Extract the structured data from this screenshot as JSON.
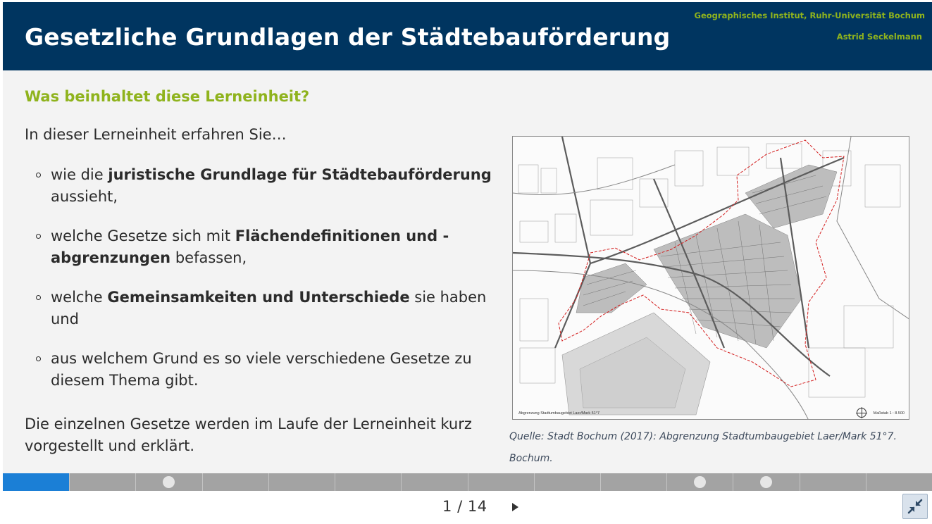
{
  "header": {
    "title": "Gesetzliche Grundlagen der Städtebauförderung",
    "institute": "Geographisches Institut, Ruhr-Universität Bochum",
    "author": "Astrid Seckelmann"
  },
  "content": {
    "subtitle": "Was beinhaltet diese Lerneinheit?",
    "intro": "In dieser Lerneinheit erfahren Sie…",
    "bullets": [
      {
        "pre": "wie die ",
        "bold": "juristische Grundlage für Städtebauförderung",
        "post": " aussieht,"
      },
      {
        "pre": "welche Gesetze sich mit ",
        "bold": "Flächendefinitionen und -abgrenzungen",
        "post": " befassen,"
      },
      {
        "pre": "welche ",
        "bold": "Gemeinsamkeiten und Unterschiede",
        "post": " sie haben und"
      },
      {
        "pre": "aus welchem Grund es so viele verschiedene Gesetze zu diesem Thema gibt.",
        "bold": "",
        "post": ""
      }
    ],
    "outro": "Die einzelnen Gesetze werden im Laufe der Lerneinheit kurz vorgestellt und erklärt."
  },
  "map": {
    "label_left": "Abgrenzung Stadtumbaugebiet Laer/Mark 51°7",
    "label_right": "Maßstab 1 : 8.500",
    "caption": "Quelle: Stadt Bochum (2017): Abgrenzung Stadtumbaugebiet Laer/Mark 51°7. Bochum."
  },
  "progress": {
    "segments": 14,
    "current": 1,
    "dot_segments": [
      3,
      11,
      12
    ]
  },
  "navigation": {
    "current_page": "1",
    "separator": "/",
    "total_pages": "14"
  },
  "colors": {
    "header_bg": "#003560",
    "accent_green": "#8fb31d",
    "progress_active": "#1b7fd6",
    "progress_inactive": "#a3a3a3",
    "boundary_red": "#d42020"
  },
  "icons": {
    "next": "triangle-right-icon",
    "fullscreen": "exit-fullscreen-icon"
  }
}
